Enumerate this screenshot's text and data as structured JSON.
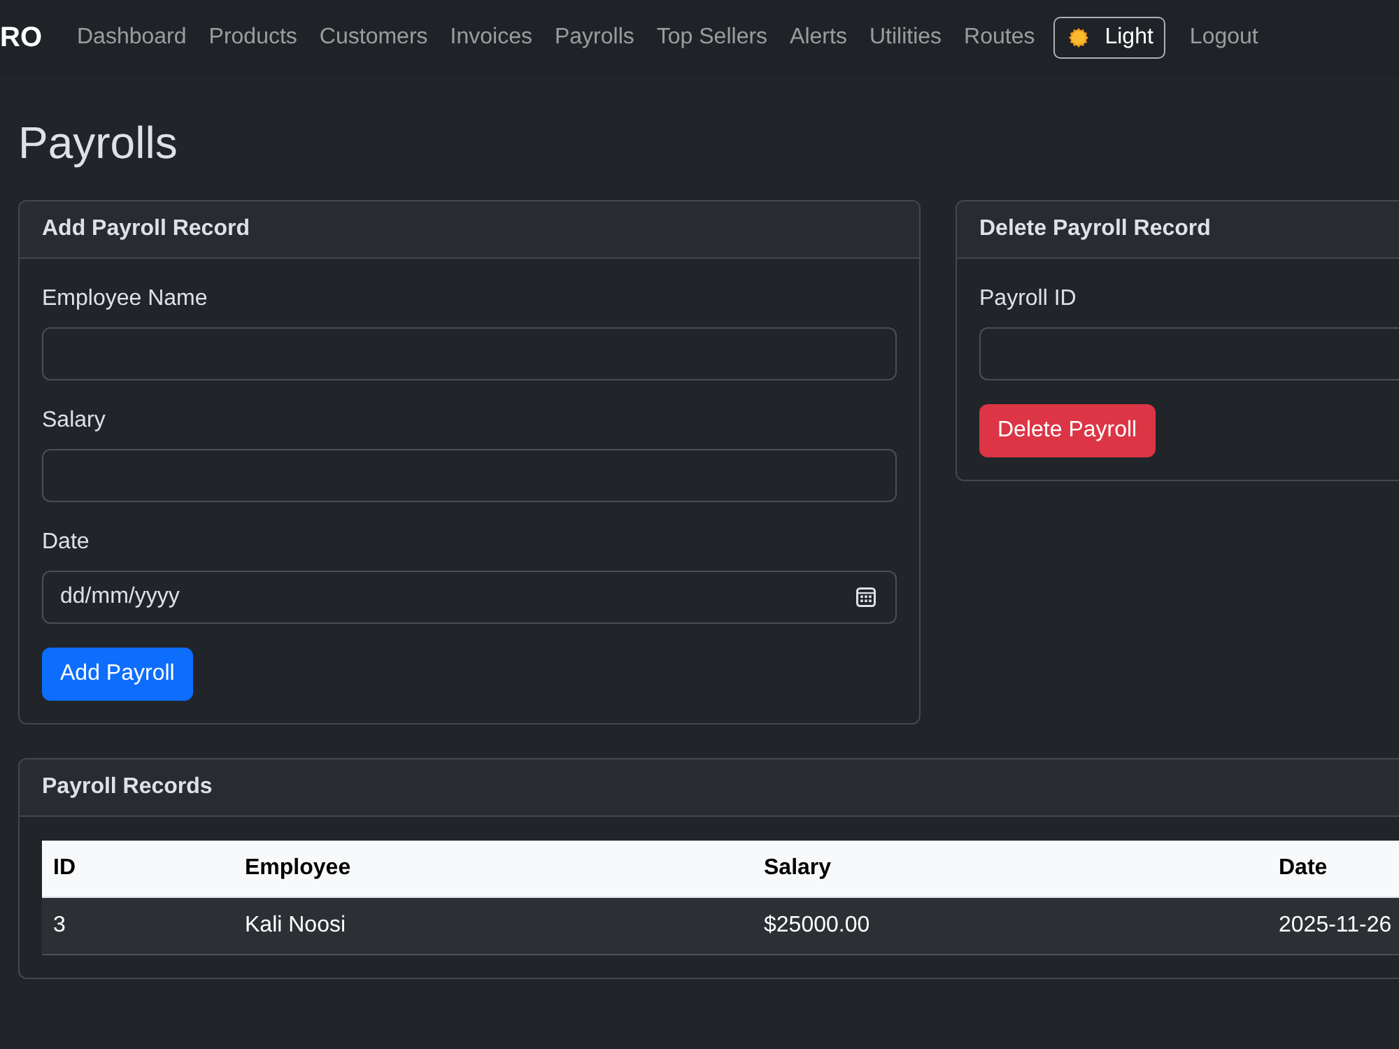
{
  "navbar": {
    "brand": "RO",
    "links": [
      "Dashboard",
      "Products",
      "Customers",
      "Invoices",
      "Payrolls",
      "Top Sellers",
      "Alerts",
      "Utilities",
      "Routes"
    ],
    "theme_toggle": {
      "label": "Light"
    },
    "logout": "Logout"
  },
  "page_title": "Payrolls",
  "add_card": {
    "title": "Add Payroll Record",
    "fields": [
      {
        "label": "Employee Name",
        "kind": "text"
      },
      {
        "label": "Salary",
        "kind": "text"
      },
      {
        "label": "Date",
        "kind": "date",
        "placeholder": "dd/mm/yyyy"
      }
    ],
    "button": {
      "label": "Add Payroll",
      "kind": "primary"
    }
  },
  "delete_card": {
    "title": "Delete Payroll Record",
    "fields": [
      {
        "label": "Payroll ID",
        "kind": "text"
      }
    ],
    "button": {
      "label": "Delete Payroll",
      "kind": "danger"
    }
  },
  "records_card": {
    "title": "Payroll Records",
    "table": {
      "columns": [
        "ID",
        "Employee",
        "Salary",
        "Date"
      ],
      "rows": [
        [
          "3",
          "Kali Noosi",
          "$25000.00",
          "2025-11-26"
        ]
      ]
    }
  }
}
